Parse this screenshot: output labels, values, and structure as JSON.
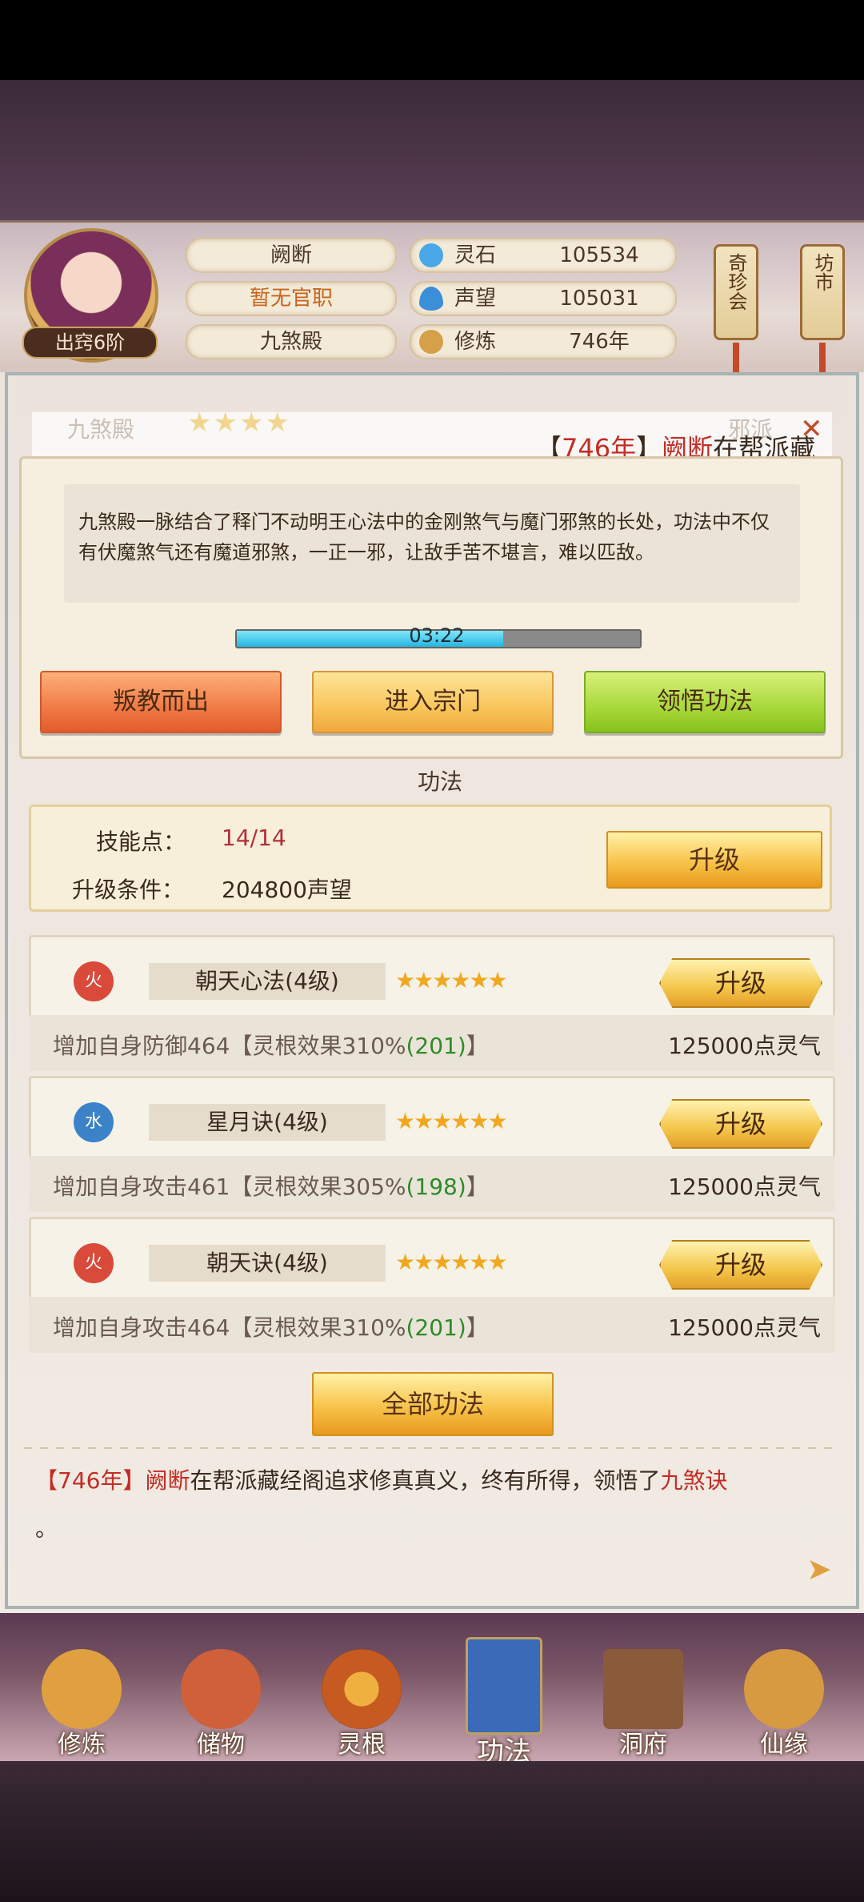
{
  "header": {
    "rank": "出窍6阶",
    "name": "阙断",
    "title": "暂无官职",
    "sect": "九煞殿",
    "stats": [
      {
        "label": "灵石",
        "value": "105534",
        "icon": "spirit-stone-icon",
        "color": "#4aa8e8"
      },
      {
        "label": "声望",
        "value": "105031",
        "icon": "prestige-flame-icon",
        "color": "#3b8fd8"
      },
      {
        "label": "修炼",
        "value": "746年",
        "icon": "meditation-icon",
        "color": "#d6a048"
      }
    ],
    "scroll_left": "奇珍会",
    "scroll_right": "坊市"
  },
  "sect_panel": {
    "faded_name": "九煞殿",
    "faded_right": "邪派",
    "announce": {
      "year": "746年",
      "name": "阙断",
      "text": "在帮派藏"
    },
    "description": "九煞殿一脉结合了释门不动明王心法中的金刚煞气与魔门邪煞的长处，功法中不仅有伏魔煞气还有魔道邪煞，一正一邪，让敌手苦不堪言，难以匹敌。",
    "timer": "03:22",
    "timer_progress": 0.66,
    "buttons": {
      "leave": "叛教而出",
      "enter": "进入宗门",
      "learn": "领悟功法"
    }
  },
  "skills_section": {
    "title": "功法",
    "points_label": "技能点：",
    "points_value": "14/14",
    "cond_label": "升级条件：",
    "cond_value": "204800声望",
    "upgrade": "升级",
    "items": [
      {
        "element": "火",
        "element_color": "#d94a3a",
        "name": "朝天心法(4级)",
        "stars": 6,
        "desc_prefix": "增加自身防御464【灵根效果310%",
        "bonus": "(201)",
        "desc_suffix": "】",
        "cost": "125000点灵气",
        "button": "升级"
      },
      {
        "element": "水",
        "element_color": "#3b82c8",
        "name": "星月诀(4级)",
        "stars": 6,
        "desc_prefix": "增加自身攻击461【灵根效果305%",
        "bonus": "(198)",
        "desc_suffix": "】",
        "cost": "125000点灵气",
        "button": "升级"
      },
      {
        "element": "火",
        "element_color": "#d94a3a",
        "name": "朝天诀(4级)",
        "stars": 6,
        "desc_prefix": "增加自身攻击464【灵根效果310%",
        "bonus": "(201)",
        "desc_suffix": "】",
        "cost": "125000点灵气",
        "button": "升级"
      }
    ],
    "all_button": "全部功法"
  },
  "log": {
    "year": "【746年】",
    "name": "阙断",
    "text": "在帮派藏经阁追求修真真义，终有所得，领悟了",
    "skill": "九煞诀",
    "end": "。"
  },
  "nav": [
    {
      "label": "修炼",
      "icon": "cultivate-icon",
      "color": "#e0a040"
    },
    {
      "label": "储物",
      "icon": "storage-bag-icon",
      "color": "#d0603a"
    },
    {
      "label": "灵根",
      "icon": "spirit-root-icon",
      "color": "#c65a20"
    },
    {
      "label": "功法",
      "icon": "skill-book-icon",
      "color": "#3a6ab8"
    },
    {
      "label": "洞府",
      "icon": "cave-house-icon",
      "color": "#8a5a3a"
    },
    {
      "label": "仙缘",
      "icon": "immortal-gourd-icon",
      "color": "#d89a40"
    }
  ]
}
